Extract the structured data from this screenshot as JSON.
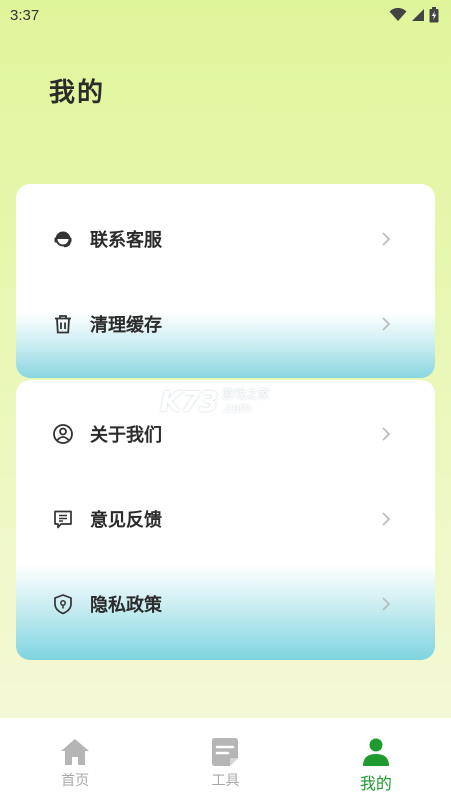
{
  "status": {
    "time": "3:37"
  },
  "header": {
    "title": "我的"
  },
  "menu": {
    "group1": [
      {
        "label": "联系客服",
        "icon": "headset-icon"
      },
      {
        "label": "清理缓存",
        "icon": "trash-icon"
      }
    ],
    "group2": [
      {
        "label": "关于我们",
        "icon": "user-circle-icon"
      },
      {
        "label": "意见反馈",
        "icon": "feedback-icon"
      },
      {
        "label": "隐私政策",
        "icon": "shield-icon"
      }
    ]
  },
  "watermark": {
    "logo": "K73",
    "line1": "游戏之家",
    "line2": ".com"
  },
  "nav": {
    "items": [
      {
        "label": "首页",
        "icon": "home-icon"
      },
      {
        "label": "工具",
        "icon": "tools-icon"
      },
      {
        "label": "我的",
        "icon": "profile-icon"
      }
    ],
    "active_color": "#1e9a2e",
    "inactive_color": "#a9a9a9"
  }
}
